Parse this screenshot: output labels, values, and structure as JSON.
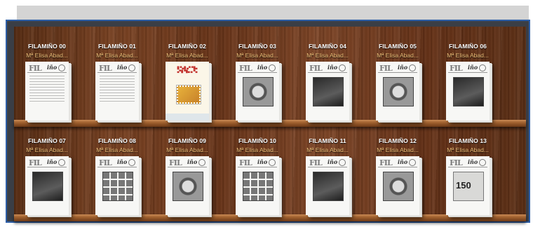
{
  "shelves": [
    {
      "books": [
        {
          "title": "FILAMIÑO 00",
          "author": "Mª Elisa Abad...",
          "cover": {
            "style": "text"
          }
        },
        {
          "title": "FILAMIÑO 01",
          "author": "Mª Elisa Abad...",
          "cover": {
            "style": "text"
          }
        },
        {
          "title": "FILAMIÑO 02",
          "author": "Mª Elisa Abad...",
          "cover": {
            "style": "color"
          }
        },
        {
          "title": "FILAMIÑO 03",
          "author": "Mª Elisa Abad...",
          "cover": {
            "style": "frame"
          }
        },
        {
          "title": "FILAMIÑO 04",
          "author": "Mª Elisa Abad...",
          "cover": {
            "style": "dark"
          }
        },
        {
          "title": "FILAMIÑO 05",
          "author": "Mª Elisa Abad...",
          "cover": {
            "style": "frame"
          }
        },
        {
          "title": "FILAMIÑO 06",
          "author": "Mª Elisa Abad...",
          "cover": {
            "style": "dark"
          }
        }
      ]
    },
    {
      "books": [
        {
          "title": "FILAMIÑO 07",
          "author": "Mª Elisa Abad...",
          "cover": {
            "style": "dark"
          }
        },
        {
          "title": "FILAMIÑO 08",
          "author": "Mª Elisa Abad...",
          "cover": {
            "style": "stamps"
          }
        },
        {
          "title": "FILAMIÑO 09",
          "author": "Mª Elisa Abad...",
          "cover": {
            "style": "frame"
          }
        },
        {
          "title": "FILAMIÑO 10",
          "author": "Mª Elisa Abad...",
          "cover": {
            "style": "stamps"
          }
        },
        {
          "title": "FILAMIÑO 11",
          "author": "Mª Elisa Abad...",
          "cover": {
            "style": "dark"
          }
        },
        {
          "title": "FILAMIÑO 12",
          "author": "Mª Elisa Abad...",
          "cover": {
            "style": "frame"
          }
        },
        {
          "title": "FILAMIÑO 13",
          "author": "Mª Elisa Abad...",
          "cover": {
            "style": "number",
            "label": "150"
          }
        }
      ]
    }
  ],
  "colors": {
    "title": "#ffffff",
    "author": "#f3c27a",
    "frame_border": "#2e5fa8",
    "wood": "#7a4222"
  }
}
